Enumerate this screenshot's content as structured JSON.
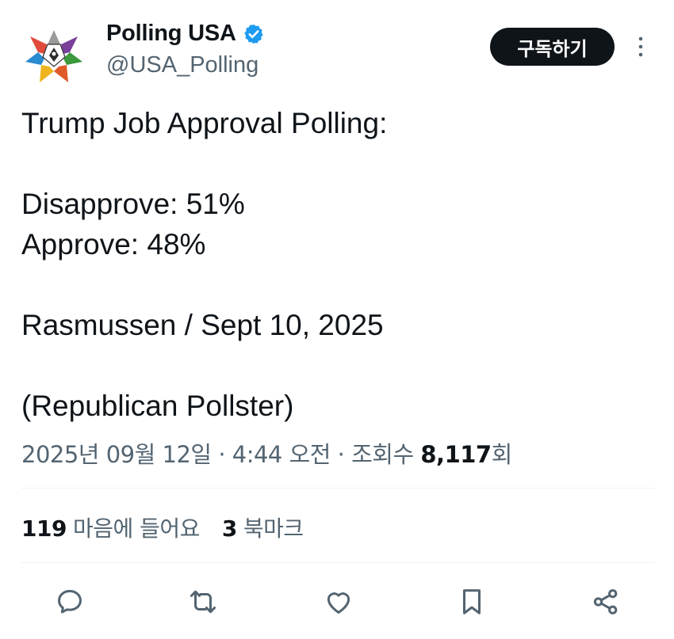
{
  "account": {
    "name": "Polling USA",
    "handle": "@USA_Polling",
    "verified_color": "#1d9bf0",
    "avatar_icon": "star-logo"
  },
  "subscribe_label": "구독하기",
  "more_icon": "more-vertical-icon",
  "tweet": {
    "lines": [
      "Trump Job Approval Polling:",
      "",
      "Disapprove: 51%",
      "Approve: 48%",
      "",
      "Rasmussen / Sept 10, 2025",
      "",
      "(Republican Pollster)"
    ]
  },
  "meta": {
    "date": "2025년 09월 12일",
    "time": "4:44 오전",
    "views_label": "조회수",
    "views_count": "8,117",
    "views_suffix": "회"
  },
  "stats": {
    "likes_count": "119",
    "likes_label": "마음에 들어요",
    "bookmarks_count": "3",
    "bookmarks_label": "북마크"
  },
  "actions": [
    "reply-icon",
    "retweet-icon",
    "like-icon",
    "bookmark-icon",
    "share-icon"
  ],
  "colors": {
    "text": "#0f1419",
    "secondary": "#536471",
    "accent": "#1d9bf0"
  }
}
